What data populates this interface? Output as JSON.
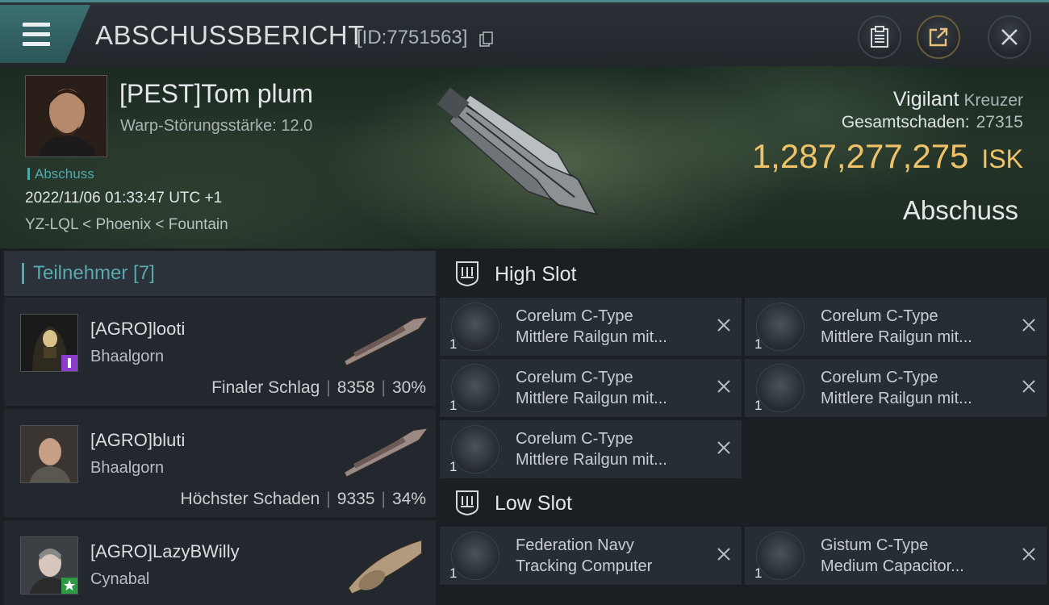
{
  "header": {
    "title": "ABSCHUSSBERICHT",
    "kill_id": "[ID:7751563]",
    "menu_icon": "hamburger-icon",
    "copy_icon": "copy-icon",
    "buttons": [
      "clipboard-icon",
      "share-icon",
      "close-icon"
    ]
  },
  "victim": {
    "name": "[PEST]Tom plum",
    "warp_disruption": "Warp-Störungsstärke: 12.0",
    "tag": "Abschuss",
    "datetime": "2022/11/06 01:33:47 UTC +1",
    "location": "YZ-LQL < Phoenix < Fountain",
    "ship_name": "Vigilant",
    "ship_class": "Kreuzer",
    "damage_label": "Gesamtschaden:",
    "damage_value": "27315",
    "isk_value": "1,287,277,275",
    "isk_unit": "ISK",
    "result": "Abschuss"
  },
  "participants": {
    "title": "Teilnehmer [7]",
    "rows": [
      {
        "name": "[AGRO]looti",
        "ship": "Bhaalgorn",
        "role": "Finaler Schlag",
        "damage": "8358",
        "percent": "30%"
      },
      {
        "name": "[AGRO]bluti",
        "ship": "Bhaalgorn",
        "role": "Höchster Schaden",
        "damage": "9335",
        "percent": "34%"
      },
      {
        "name": "[AGRO]LazyBWilly",
        "ship": "Cynabal",
        "role": "",
        "damage": "",
        "percent": ""
      }
    ]
  },
  "fittings": {
    "high_slot": {
      "title": "High Slot",
      "modules": [
        {
          "qty": "1",
          "line1": "Corelum C-Type",
          "line2": "Mittlere Railgun mit..."
        },
        {
          "qty": "1",
          "line1": "Corelum C-Type",
          "line2": "Mittlere Railgun mit..."
        },
        {
          "qty": "1",
          "line1": "Corelum C-Type",
          "line2": "Mittlere Railgun mit..."
        },
        {
          "qty": "1",
          "line1": "Corelum C-Type",
          "line2": "Mittlere Railgun mit..."
        },
        {
          "qty": "1",
          "line1": "Corelum C-Type",
          "line2": "Mittlere Railgun mit..."
        }
      ]
    },
    "low_slot": {
      "title": "Low Slot",
      "modules": [
        {
          "qty": "1",
          "line1": "Federation Navy",
          "line2": "Tracking Computer"
        },
        {
          "qty": "1",
          "line1": "Gistum C-Type",
          "line2": "Medium Capacitor..."
        }
      ]
    }
  },
  "colors": {
    "accent": "#4fa9ae",
    "isk": "#f0c36a",
    "panel": "#262d34"
  }
}
